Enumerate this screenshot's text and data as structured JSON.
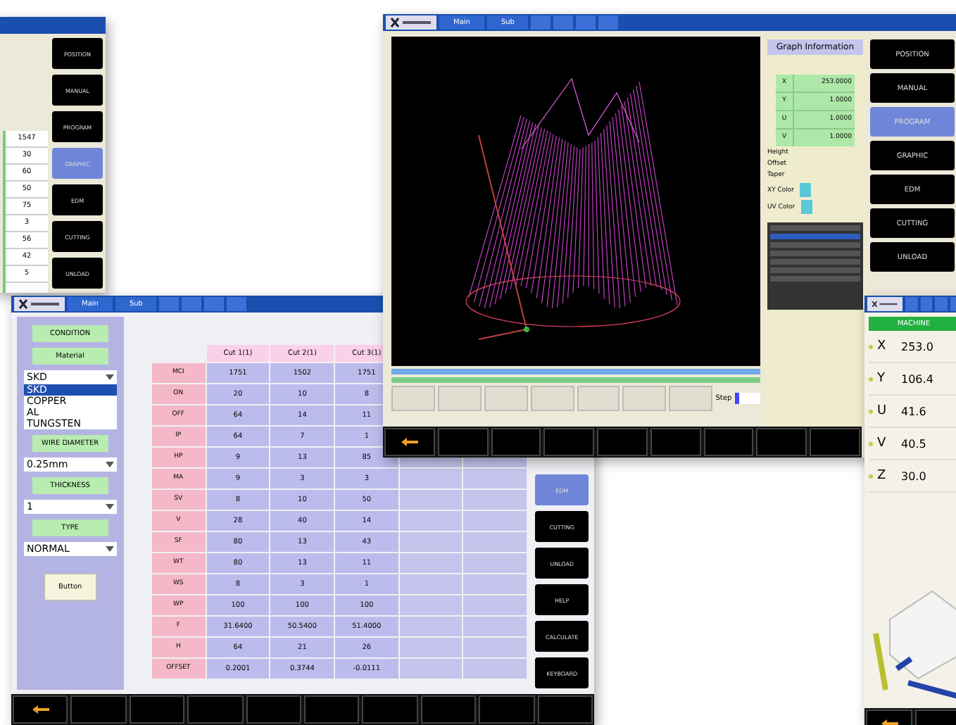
{
  "program_window": {
    "values": [
      "1547",
      "30",
      "60",
      "50",
      "75",
      "3",
      "56",
      "42",
      "5"
    ],
    "menu": [
      {
        "label": "POSITION",
        "selected": false
      },
      {
        "label": "MANUAL",
        "selected": false
      },
      {
        "label": "PROGRAM",
        "selected": false
      },
      {
        "label": "GRAPHIC",
        "selected": true
      },
      {
        "label": "EDM",
        "selected": false
      },
      {
        "label": "CUTTING",
        "selected": false
      },
      {
        "label": "UNLOAD",
        "selected": false
      }
    ]
  },
  "graph_window": {
    "tabs": [
      {
        "label": "Main",
        "selected": false
      },
      {
        "label": "Sub",
        "selected": false
      }
    ],
    "info_title": "Graph Information",
    "coords": [
      {
        "axis": "X",
        "value": "253.0000"
      },
      {
        "axis": "Y",
        "value": "1.0000"
      },
      {
        "axis": "U",
        "value": "1.0000"
      },
      {
        "axis": "V",
        "value": "1.0000"
      }
    ],
    "params": [
      "Height",
      "Offset",
      "Taper"
    ],
    "colors": [
      {
        "label": "XY Color",
        "color": "#5bc8d8"
      },
      {
        "label": "UV Color",
        "color": "#5bc8d8"
      }
    ],
    "listing": [
      {
        "selected": false
      },
      {
        "selected": true
      },
      {
        "selected": false
      },
      {
        "selected": false
      },
      {
        "selected": false
      },
      {
        "selected": false
      },
      {
        "selected": false
      }
    ],
    "menu": [
      {
        "label": "POSITION",
        "selected": false
      },
      {
        "label": "MANUAL",
        "selected": false
      },
      {
        "label": "PROGRAM",
        "selected": true
      },
      {
        "label": "GRAPHIC",
        "selected": false
      },
      {
        "label": "EDM",
        "selected": false
      },
      {
        "label": "CUTTING",
        "selected": false
      },
      {
        "label": "UNLOAD",
        "selected": false
      }
    ],
    "bars": [
      {
        "level": 1
      },
      {
        "level": 1
      }
    ],
    "step_label": "Step"
  },
  "condition_window": {
    "tabs": [
      {
        "label": "Main",
        "selected": false
      },
      {
        "label": "Sub",
        "selected": false
      }
    ],
    "sidebar": [
      {
        "kind": "header",
        "label": "CONDITION"
      },
      {
        "kind": "header",
        "label": "Material"
      },
      {
        "kind": "select",
        "value": "SKD"
      },
      {
        "kind": "list",
        "items": [
          {
            "label": "SKD",
            "selected": true
          },
          {
            "label": "COPPER",
            "selected": false
          },
          {
            "label": "AL",
            "selected": false
          },
          {
            "label": "TUNGSTEN",
            "selected": false
          }
        ]
      },
      {
        "kind": "header",
        "label": "WIRE DIAMETER"
      },
      {
        "kind": "select",
        "value": "0.25mm"
      },
      {
        "kind": "header",
        "label": "THICKNESS"
      },
      {
        "kind": "select",
        "value": "1"
      },
      {
        "kind": "header",
        "label": "TYPE"
      },
      {
        "kind": "select",
        "value": "NORMAL"
      },
      {
        "kind": "button",
        "label": "Button"
      }
    ],
    "columns": [
      "Cut 1(1)",
      "Cut 2(1)",
      "Cut 3(1)"
    ],
    "rows": [
      {
        "label": "MCI",
        "values": [
          "1751",
          "1502",
          "1751"
        ]
      },
      {
        "label": "ON",
        "values": [
          "20",
          "10",
          "8"
        ]
      },
      {
        "label": "OFF",
        "values": [
          "64",
          "14",
          "11"
        ]
      },
      {
        "label": "IP",
        "values": [
          "64",
          "7",
          "1"
        ]
      },
      {
        "label": "HP",
        "values": [
          "9",
          "13",
          "85"
        ]
      },
      {
        "label": "MA",
        "values": [
          "9",
          "3",
          "3"
        ]
      },
      {
        "label": "SV",
        "values": [
          "8",
          "10",
          "50"
        ]
      },
      {
        "label": "V",
        "values": [
          "28",
          "40",
          "14"
        ]
      },
      {
        "label": "SF",
        "values": [
          "80",
          "13",
          "43"
        ]
      },
      {
        "label": "WT",
        "values": [
          "80",
          "13",
          "11"
        ]
      },
      {
        "label": "WS",
        "values": [
          "8",
          "3",
          "1"
        ]
      },
      {
        "label": "WP",
        "values": [
          "100",
          "100",
          "100"
        ]
      },
      {
        "label": "F",
        "values": [
          "31.6400",
          "50.5400",
          "51.4000"
        ]
      },
      {
        "label": "H",
        "values": [
          "64",
          "21",
          "26"
        ]
      },
      {
        "label": "OFFSET",
        "values": [
          "0.2001",
          "0.3744",
          "-0.0111"
        ]
      }
    ],
    "side_buttons": [
      {
        "label": "EDM",
        "selected": true
      },
      {
        "label": "CUTTING",
        "selected": false
      },
      {
        "label": "UNLOAD",
        "selected": false
      },
      {
        "label": "HELP",
        "selected": false
      },
      {
        "label": "CALCULATE",
        "selected": false
      },
      {
        "label": "KEYBOARD",
        "selected": false
      }
    ]
  },
  "machine_window": {
    "title": "MACHINE",
    "axes": [
      {
        "axis": "X",
        "value": "253.0"
      },
      {
        "axis": "Y",
        "value": "106.4"
      },
      {
        "axis": "U",
        "value": "41.6"
      },
      {
        "axis": "V",
        "value": "40.5"
      },
      {
        "axis": "Z",
        "value": "30.0"
      }
    ]
  }
}
